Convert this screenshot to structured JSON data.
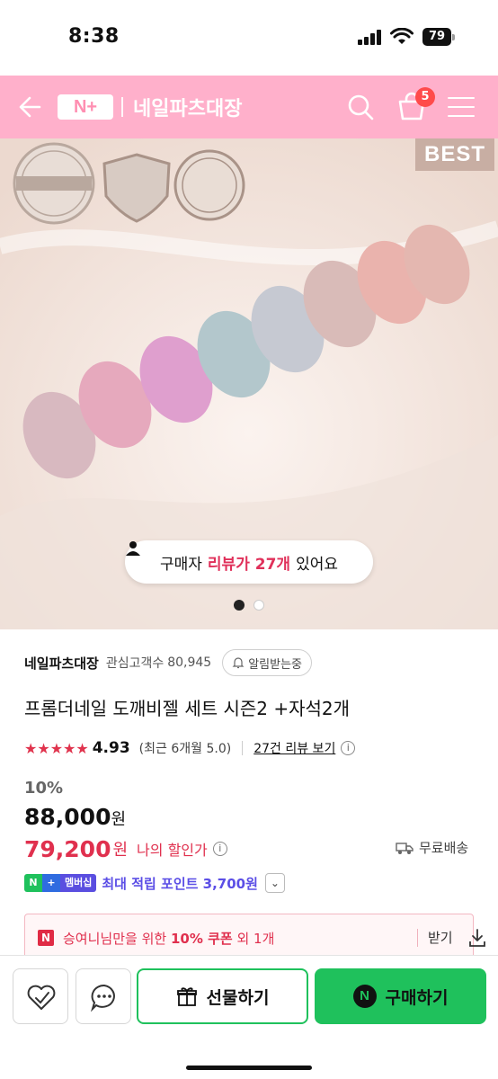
{
  "status_bar": {
    "time": "8:38",
    "battery": "79"
  },
  "header": {
    "logo_text": "N+",
    "store_name": "네일파츠대장",
    "cart_count": "5",
    "background_color": "#ffb0cb"
  },
  "product_image": {
    "best_label": "BEST",
    "review_pill": {
      "prefix": "구매자",
      "highlight": "리뷰가 27개",
      "suffix": "있어요"
    },
    "slide_count": 2,
    "active_slide": 1
  },
  "seller": {
    "name": "네일파츠대장",
    "fans_label": "관심고객수",
    "fans_count": "80,945",
    "alarm_label": "알림받는중"
  },
  "product": {
    "title": "프롬더네일 도깨비젤 세트 시즌2 +자석2개",
    "stars": "★★★★★",
    "rating": "4.93",
    "recent_rating": "(최근 6개월 5.0)",
    "review_link": "27건 리뷰 보기",
    "discount_rate": "10%",
    "original_price": "88,000",
    "sale_price": "79,200",
    "currency": "원",
    "my_discount_label": "나의 할인가",
    "shipping": "무료배송",
    "accent_color": "#e0304e"
  },
  "membership": {
    "badge_label": "멤버십",
    "text": "최대 적립 포인트 3,700원"
  },
  "coupon": {
    "prefix": "승여니님만을 위한",
    "highlight": "10% 쿠폰",
    "suffix": "외 1개",
    "get_label": "받기"
  },
  "bottom_bar": {
    "gift_label": "선물하기",
    "buy_label": "구매하기",
    "brand_green": "#1fc15c"
  }
}
